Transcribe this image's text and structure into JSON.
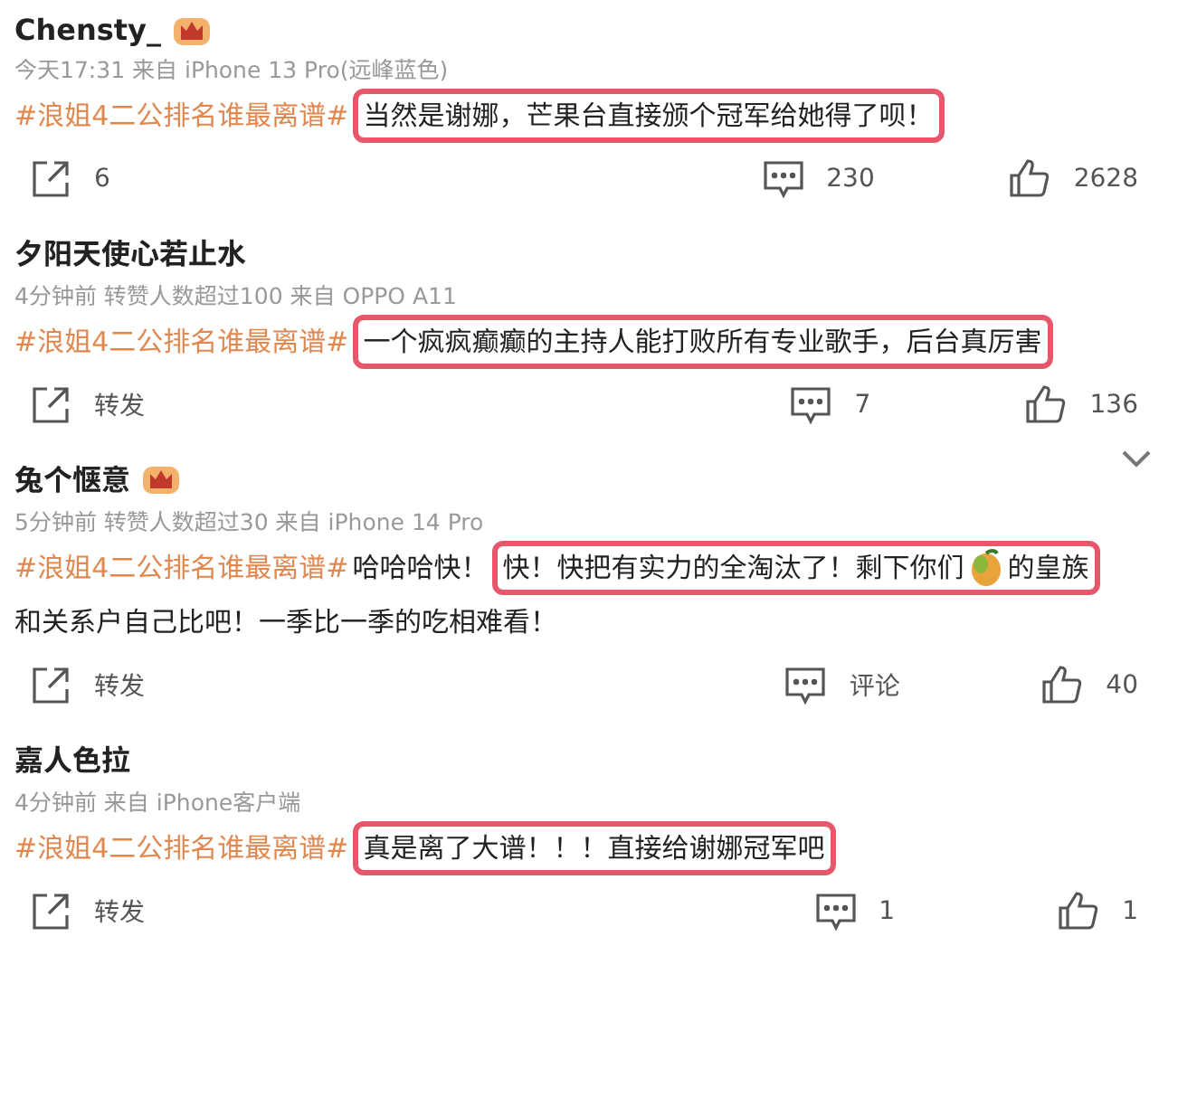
{
  "posts": [
    {
      "username": "Chensty_",
      "vip": true,
      "meta": "今天17:31  来自 iPhone 13 Pro(远峰蓝色)",
      "hashtag": "#浪姐4二公排名谁最离谱#",
      "highlight": [
        "当然是谢娜，芒果台直接颁个冠军给她得了呗！"
      ],
      "collapse": false,
      "repost": "6",
      "comment": "230",
      "likes": "2628"
    },
    {
      "username": "夕阳天使心若止水",
      "vip": false,
      "meta": "4分钟前  转赞人数超过100  来自 OPPO A11",
      "hashtag": "#浪姐4二公排名谁最离谱#",
      "highlight": [
        "一个疯疯癫癫的主持人能打败所有专业歌手，后台真厉害"
      ],
      "collapse": false,
      "repost": "转发",
      "comment": "7",
      "likes": "136"
    },
    {
      "username": "兔个惬意",
      "vip": true,
      "meta": "5分钟前  转赞人数超过30  来自 iPhone 14 Pro",
      "hashtag": "#浪姐4二公排名谁最离谱#",
      "text_before": "哈哈哈快！",
      "highlight": [
        "快！快把有实力的全淘汰了！剩下你们",
        "的皇族"
      ],
      "text_after": "和关系户自己比吧！一季比一季的吃相难看！",
      "collapse": true,
      "repost": "转发",
      "comment": "评论",
      "likes": "40"
    },
    {
      "username": "嘉人色拉",
      "vip": false,
      "meta": "4分钟前  来自 iPhone客户端",
      "hashtag": "#浪姐4二公排名谁最离谱#",
      "highlight": [
        "真是离了大谱！！！直接给谢娜冠军吧"
      ],
      "collapse": false,
      "repost": "转发",
      "comment": "1",
      "likes": "1"
    }
  ]
}
